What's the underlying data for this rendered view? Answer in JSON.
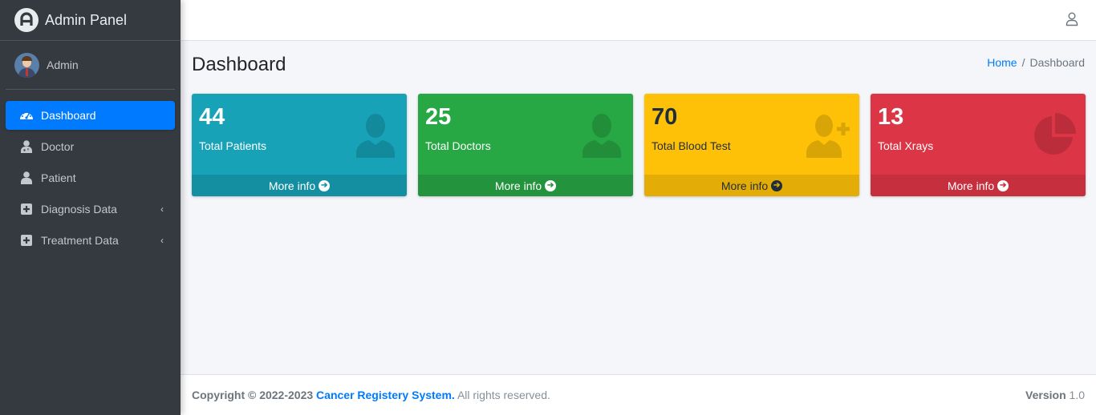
{
  "brand": {
    "title": "Admin Panel"
  },
  "user": {
    "name": "Admin"
  },
  "sidebar": {
    "items": [
      {
        "label": "Dashboard",
        "icon": "tachometer-icon",
        "active": true
      },
      {
        "label": "Doctor",
        "icon": "user-doctor-icon"
      },
      {
        "label": "Patient",
        "icon": "user-icon"
      },
      {
        "label": "Diagnosis Data",
        "icon": "plus-square-icon",
        "arrow": "‹"
      },
      {
        "label": "Treatment Data",
        "icon": "plus-square-icon",
        "arrow": "‹"
      }
    ]
  },
  "header": {
    "title": "Dashboard"
  },
  "breadcrumb": {
    "home": "Home",
    "separator": "/",
    "current": "Dashboard"
  },
  "boxes": [
    {
      "value": "44",
      "label": "Total Patients",
      "footer": "More info",
      "color": "#17a2b8",
      "icon": "user-icon"
    },
    {
      "value": "25",
      "label": "Total Doctors",
      "footer": "More info",
      "color": "#28a745",
      "icon": "user-icon"
    },
    {
      "value": "70",
      "label": "Total Blood Test",
      "footer": "More info",
      "color": "#ffc107",
      "icon": "user-plus-icon"
    },
    {
      "value": "13",
      "label": "Total Xrays",
      "footer": "More info",
      "color": "#dc3545",
      "icon": "pie-chart-icon"
    }
  ],
  "footer": {
    "copyright": "Copyright © 2022-2023",
    "org": "Cancer Registery System.",
    "rights": "All rights reserved.",
    "version_label": "Version",
    "version": "1.0"
  },
  "colors": {
    "accent": "#007bff",
    "sidebar": "#343a40"
  }
}
